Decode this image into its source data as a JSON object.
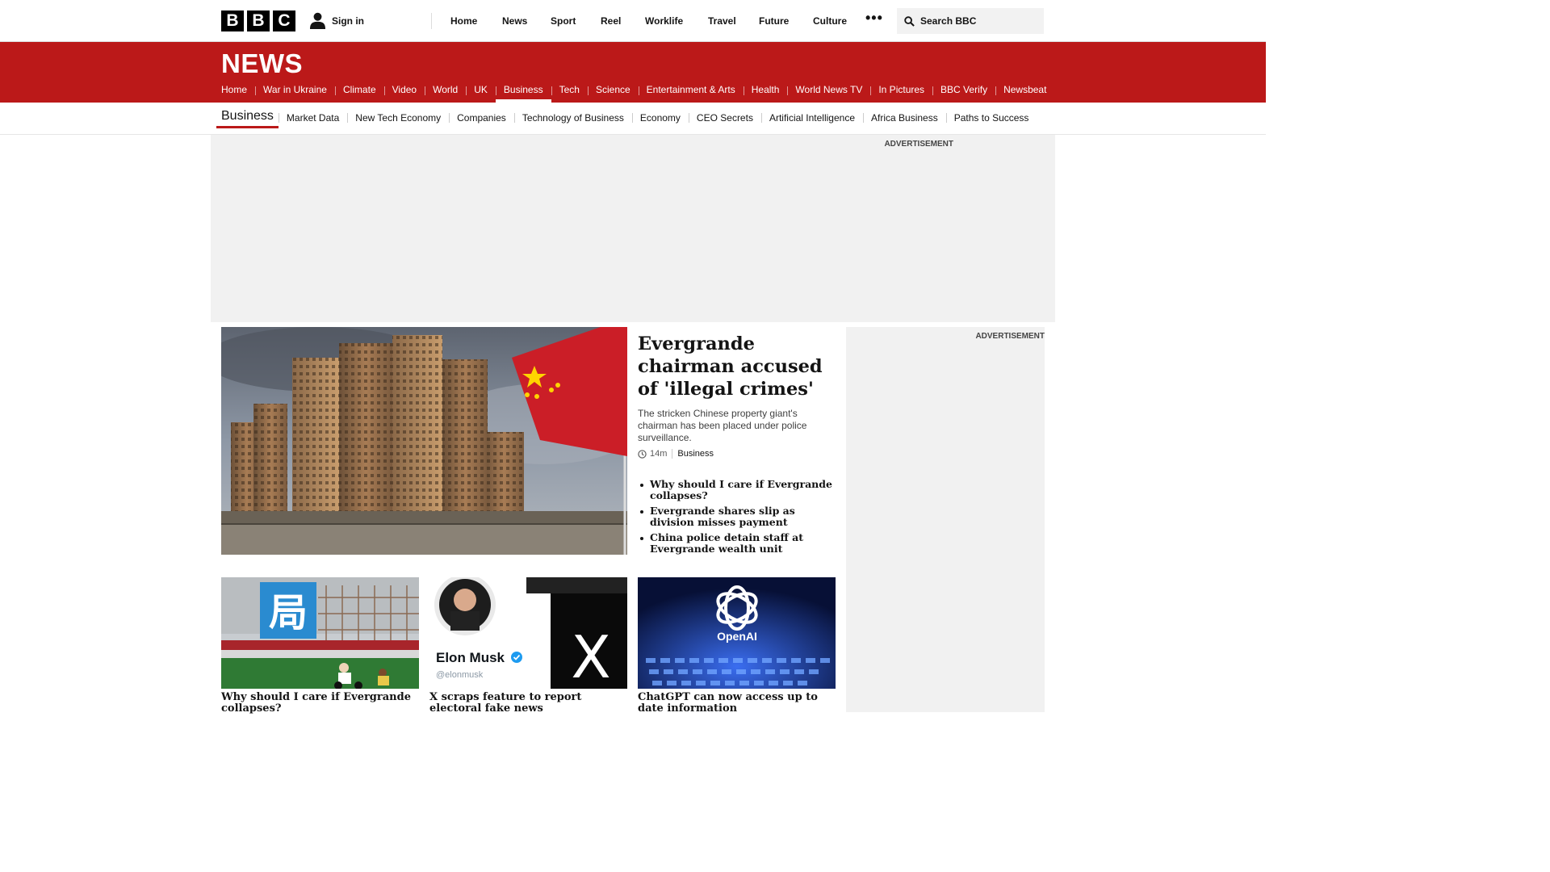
{
  "topbar": {
    "logo_letters": [
      "B",
      "B",
      "C"
    ],
    "signin": "Sign in",
    "nav": [
      "Home",
      "News",
      "Sport",
      "Reel",
      "Worklife",
      "Travel",
      "Future",
      "Culture"
    ],
    "more": "•••",
    "search_placeholder": "Search BBC"
  },
  "news": {
    "title": "NEWS",
    "nav": [
      "Home",
      "War in Ukraine",
      "Climate",
      "Video",
      "World",
      "UK",
      "Business",
      "Tech",
      "Science",
      "Entertainment & Arts",
      "Health",
      "World News TV",
      "In Pictures",
      "BBC Verify",
      "Newsbeat"
    ],
    "active_index": 6
  },
  "business": {
    "title": "Business",
    "nav": [
      "Market Data",
      "New Tech Economy",
      "Companies",
      "Technology of Business",
      "Economy",
      "CEO Secrets",
      "Artificial Intelligence",
      "Africa Business",
      "Paths to Success"
    ]
  },
  "ads": {
    "label": "ADVERTISEMENT"
  },
  "hero": {
    "headline": "Evergrande chairman accused of 'illegal crimes'",
    "summary": "The stricken Chinese property giant's chairman has been placed under police surveillance.",
    "time": "14m",
    "tag": "Business",
    "related": [
      "Why should I care if Evergrande collapses?",
      "Evergrande shares slip as division misses payment",
      "China police detain staff at Evergrande wealth unit"
    ]
  },
  "cards": [
    {
      "headline": "Why should I care if Evergrande collapses?",
      "image_text": "局"
    },
    {
      "headline": "X scraps feature to report electoral fake news",
      "image_name": "Elon Musk",
      "image_handle": "@elonmusk",
      "image_letter": "X"
    },
    {
      "headline": "ChatGPT can now access up to date information",
      "image_text": "OpenAI"
    }
  ],
  "colors": {
    "brand_red": "#bb1919",
    "text": "#141414"
  }
}
